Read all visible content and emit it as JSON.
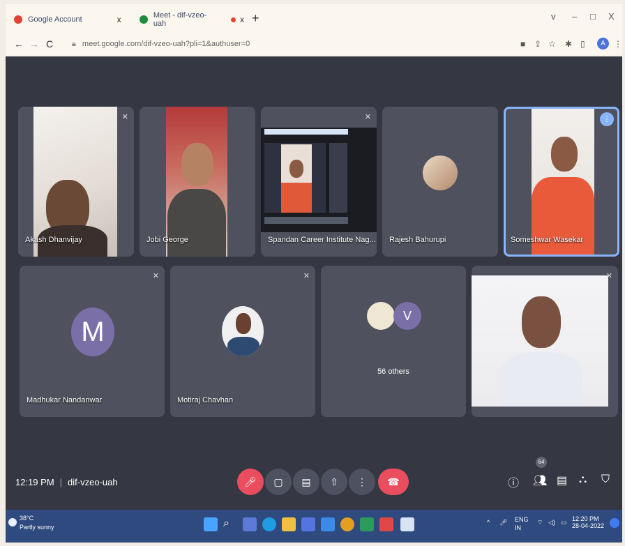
{
  "browser": {
    "tabs": [
      {
        "label": "Google Account",
        "close": "x",
        "icon": "google-icon",
        "color": "#e34133"
      },
      {
        "label": "Meet - dif-vzeo-uah",
        "close": "x",
        "icon": "meet-icon",
        "color": "#1e8e3e"
      }
    ],
    "new_tab": "+",
    "window_controls": {
      "menu": "v",
      "minimize": "–",
      "restore": "□",
      "close": "X"
    },
    "url": "meet.google.com/dif-vzeo-uah?pli=1&authuser=0",
    "profile_letter": "A"
  },
  "participants": [
    {
      "name": "Akash Dhanvijay",
      "muted": true
    },
    {
      "name": "Jobi George",
      "muted": false
    },
    {
      "name": "Spandan Career Institute Nag...",
      "muted": true
    },
    {
      "name": "Rajesh Bahurupi",
      "muted": false
    },
    {
      "name": "Someshwar Wasekar",
      "muted": false,
      "speaking": true
    },
    {
      "name": "Madhukar Nandanwar",
      "muted": true,
      "letter": "M"
    },
    {
      "name": "Motiraj Chavhan",
      "muted": true
    },
    {
      "name": "56 others",
      "letter": "V"
    },
    {
      "name": "",
      "muted": true
    }
  ],
  "meeting": {
    "time": "12:19 PM",
    "code": "dif-vzeo-uah",
    "participant_count": "64",
    "end_color": "#ea4e5e",
    "mic_color": "#ea4e5e"
  },
  "taskbar": {
    "temp": "38°C",
    "weather": "Partly sunny",
    "lang": "ENG",
    "region": "IN",
    "time": "12:20 PM",
    "date": "28-04-2022"
  }
}
